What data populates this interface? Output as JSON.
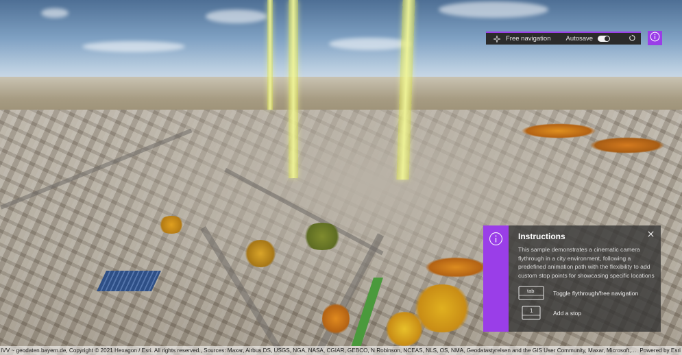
{
  "toolbar": {
    "navigation_mode_label": "Free navigation",
    "navigation_icon": "compass-icon",
    "autosave_label": "Autosave",
    "autosave_on": true,
    "reset_icon": "reset-icon",
    "accent_color": "#9a3ee8"
  },
  "info_button_icon": "info-icon",
  "instructions": {
    "title": "Instructions",
    "description": "This sample demonstrates a cinematic camera flythrough in a city environment, following a predefined animation path with the flexibility to add custom stop points for showcasing specific locations or details.",
    "shortcuts": [
      {
        "key": "tab",
        "label": "Toggle flythrough/free navigation"
      },
      {
        "key": "1",
        "label": "Add a stop"
      }
    ],
    "close_icon": "close-icon",
    "info_icon": "info-icon"
  },
  "attribution": {
    "text": "IVV ~ geodaten.bayern.de, Copyright © 2021 Hexagon / Esri. All rights reserved., Sources: Maxar, Airbus DS, USGS, NGA, NASA, CGIAR, GEBCO, N Robinson, NCEAS, NLS, OS, NMA, Geodatastyrelsen and the GIS User Community, Maxar, Microsoft, Earth...",
    "powered_by": "Powered by Esri"
  }
}
